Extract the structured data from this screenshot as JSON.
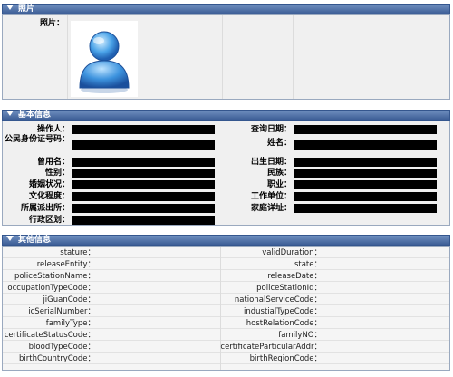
{
  "sections": {
    "photo": {
      "title": "照片",
      "photo_label": "照片："
    },
    "basic": {
      "title": "基本信息",
      "left_fields": [
        "操作人：",
        "公民身份证号码：",
        "曾用名：",
        "性别：",
        "婚姻状况：",
        "文化程度：",
        "所属派出所：",
        "行政区划："
      ],
      "right_fields": [
        "查询日期：",
        "姓名：",
        "出生日期：",
        "民族：",
        "职业：",
        "工作单位：",
        "家庭详址："
      ]
    },
    "other": {
      "title": "其他信息",
      "left_fields": [
        "stature：",
        "releaseEntity：",
        "policeStationName：",
        "occupationTypeCode：",
        "jiGuanCode：",
        "icSerialNumber：",
        "familyType：",
        "certificateStatusCode：",
        "bloodTypeCode：",
        "birthCountryCode："
      ],
      "right_fields": [
        "validDuration：",
        "state：",
        "releaseDate：",
        "policeStationId：",
        "nationalServiceCode：",
        "industialTypeCode：",
        "hostRelationCode：",
        "familyNO：",
        "certificateParticularAddr：",
        "birthRegionCode："
      ]
    }
  },
  "colors": {
    "header_bg": "#4d6ea6",
    "header_text": "#ffffff",
    "panel_bg": "#f0f0f0",
    "redaction": "#000000"
  },
  "icons": {
    "avatar": "user-avatar-icon",
    "collapse": "triangle-down-icon"
  }
}
